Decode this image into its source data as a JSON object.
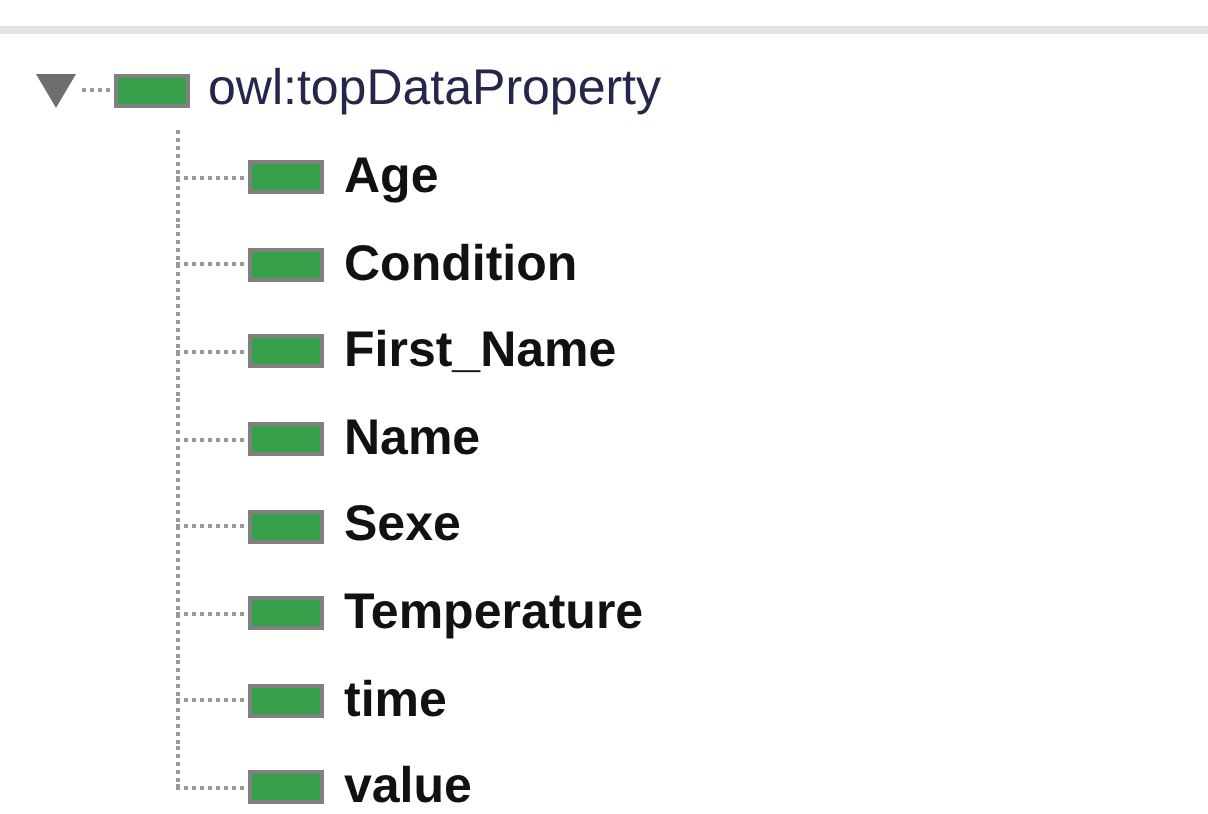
{
  "tree": [
    {
      "label": "owl:topDataProperty",
      "expanded": true,
      "children": [
        {
          "label": "Age"
        },
        {
          "label": "Condition"
        },
        {
          "label": "First_Name"
        },
        {
          "label": "Name"
        },
        {
          "label": "Sexe"
        },
        {
          "label": "Temperature"
        },
        {
          "label": "time"
        },
        {
          "label": "value"
        }
      ]
    }
  ]
}
